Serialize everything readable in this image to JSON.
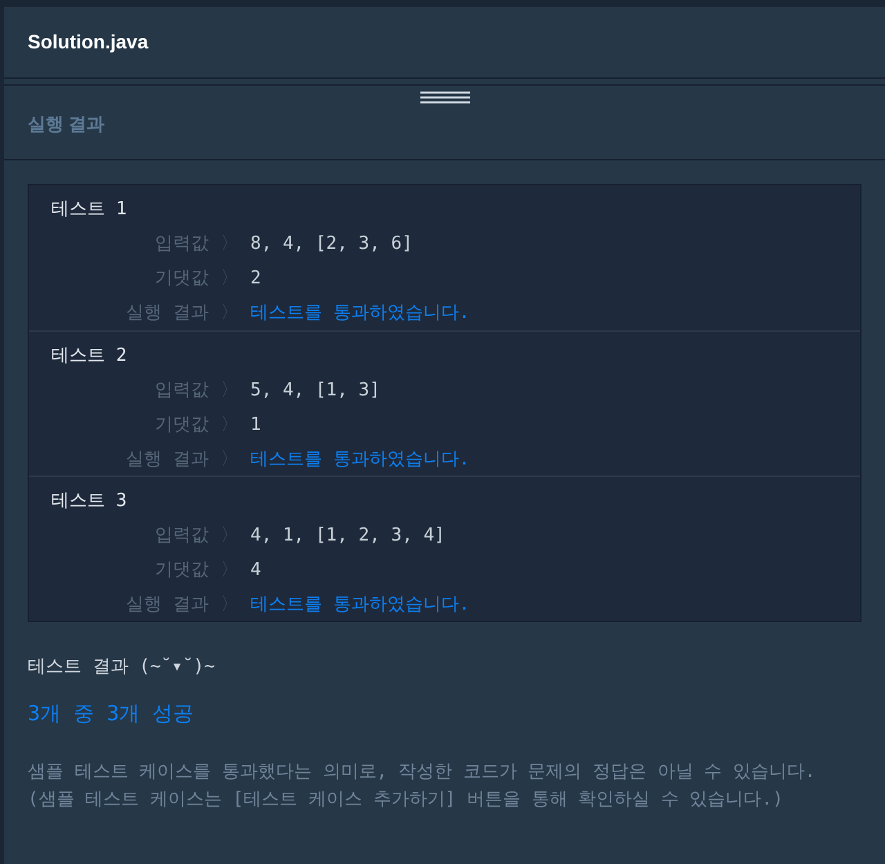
{
  "editor_tab": {
    "title": "Solution.java"
  },
  "panel": {
    "title": "실행 결과"
  },
  "tests": [
    {
      "title": "테스트 1",
      "rows": [
        {
          "label": "입력값",
          "value": "8, 4, [2, 3, 6]",
          "kind": "plain"
        },
        {
          "label": "기댓값",
          "value": "2",
          "kind": "plain"
        },
        {
          "label": "실행 결과",
          "value": "테스트를 통과하였습니다.",
          "kind": "pass"
        }
      ]
    },
    {
      "title": "테스트 2",
      "rows": [
        {
          "label": "입력값",
          "value": "5, 4, [1, 3]",
          "kind": "plain"
        },
        {
          "label": "기댓값",
          "value": "1",
          "kind": "plain"
        },
        {
          "label": "실행 결과",
          "value": "테스트를 통과하였습니다.",
          "kind": "pass"
        }
      ]
    },
    {
      "title": "테스트 3",
      "rows": [
        {
          "label": "입력값",
          "value": "4, 1, [1, 2, 3, 4]",
          "kind": "plain"
        },
        {
          "label": "기댓값",
          "value": "4",
          "kind": "plain"
        },
        {
          "label": "실행 결과",
          "value": "테스트를 통과하였습니다.",
          "kind": "pass"
        }
      ]
    }
  ],
  "separator": "〉",
  "summary": {
    "title": "테스트 결과 (~˘▾˘)~",
    "score": "3개 중 3개 성공",
    "note": "샘플 테스트 케이스를 통과했다는 의미로, 작성한 코드가 문제의 정답은 아닐 수 있습니다.",
    "hint": "(샘플 테스트 케이스는 [테스트 케이스 추가하기] 버튼을 통해 확인하실 수 있습니다.)"
  }
}
